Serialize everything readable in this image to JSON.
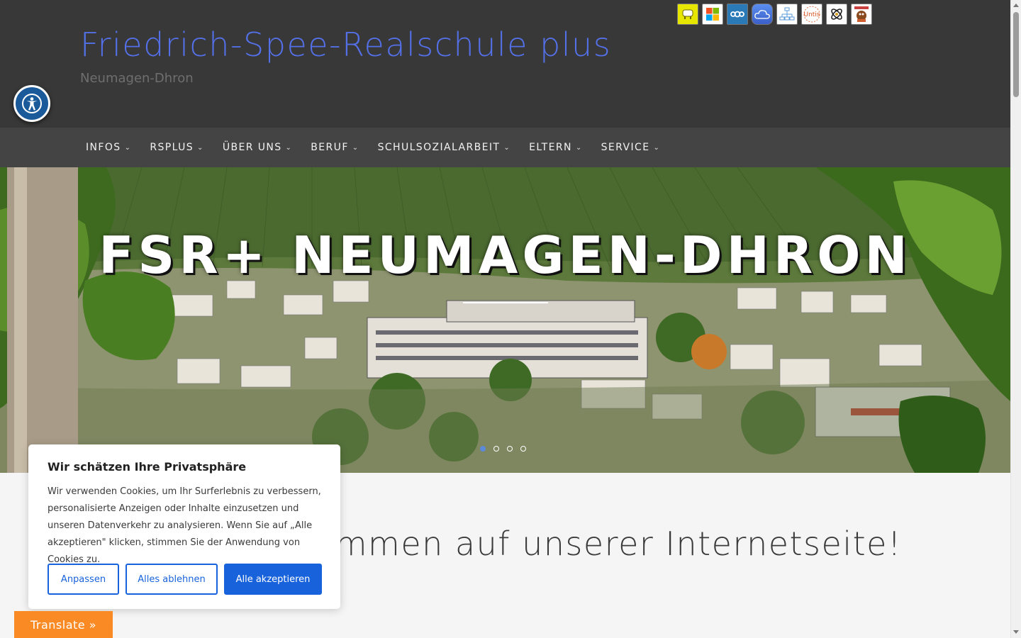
{
  "header": {
    "site_title": "Friedrich-Spee-Realschule plus",
    "tagline": "Neumagen-Dhron",
    "quick_links": [
      {
        "name": "bus-app-icon",
        "bg": "#e6e600"
      },
      {
        "name": "microsoft-icon",
        "bg": "#ffffff"
      },
      {
        "name": "nextcloud-icon",
        "bg": "#2a7ab8"
      },
      {
        "name": "cloud-icon",
        "bg": "#3b6fd6"
      },
      {
        "name": "sitemap-icon",
        "bg": "#ffffff"
      },
      {
        "name": "untis-icon",
        "bg": "#ffffff"
      },
      {
        "name": "atom-icon",
        "bg": "#ffffff"
      },
      {
        "name": "mascot-icon",
        "bg": "#ffffff"
      }
    ],
    "untis_label": "Untis"
  },
  "nav": {
    "items": [
      {
        "label": "INFOS"
      },
      {
        "label": "RSPLUS"
      },
      {
        "label": "ÜBER UNS"
      },
      {
        "label": "BERUF"
      },
      {
        "label": "SCHULSOZIALARBEIT"
      },
      {
        "label": "ELTERN"
      },
      {
        "label": "SERVICE"
      }
    ]
  },
  "hero": {
    "title": "FSR+ NEUMAGEN-DHRON",
    "slides": 4,
    "active_slide": 1
  },
  "main": {
    "welcome_visible": "ommen auf unserer Internetseite!"
  },
  "cookie": {
    "title": "Wir schätzen Ihre Privatsphäre",
    "text": "Wir verwenden Cookies, um Ihr Surferlebnis zu verbessern, personalisierte Anzeigen oder Inhalte einzusetzen und unseren Datenverkehr zu analysieren. Wenn Sie auf „Alle akzeptieren\" klicken, stimmen Sie der Anwendung von Cookies zu.",
    "btn_customize": "Anpassen",
    "btn_reject": "Alles ablehnen",
    "btn_accept": "Alle akzeptieren"
  },
  "translate": {
    "label": "Translate »"
  },
  "colors": {
    "header_bg": "#383838",
    "nav_bg": "#444444",
    "title": "#5470e8",
    "accent_blue": "#1863dc",
    "translate_orange": "#f98a24"
  }
}
